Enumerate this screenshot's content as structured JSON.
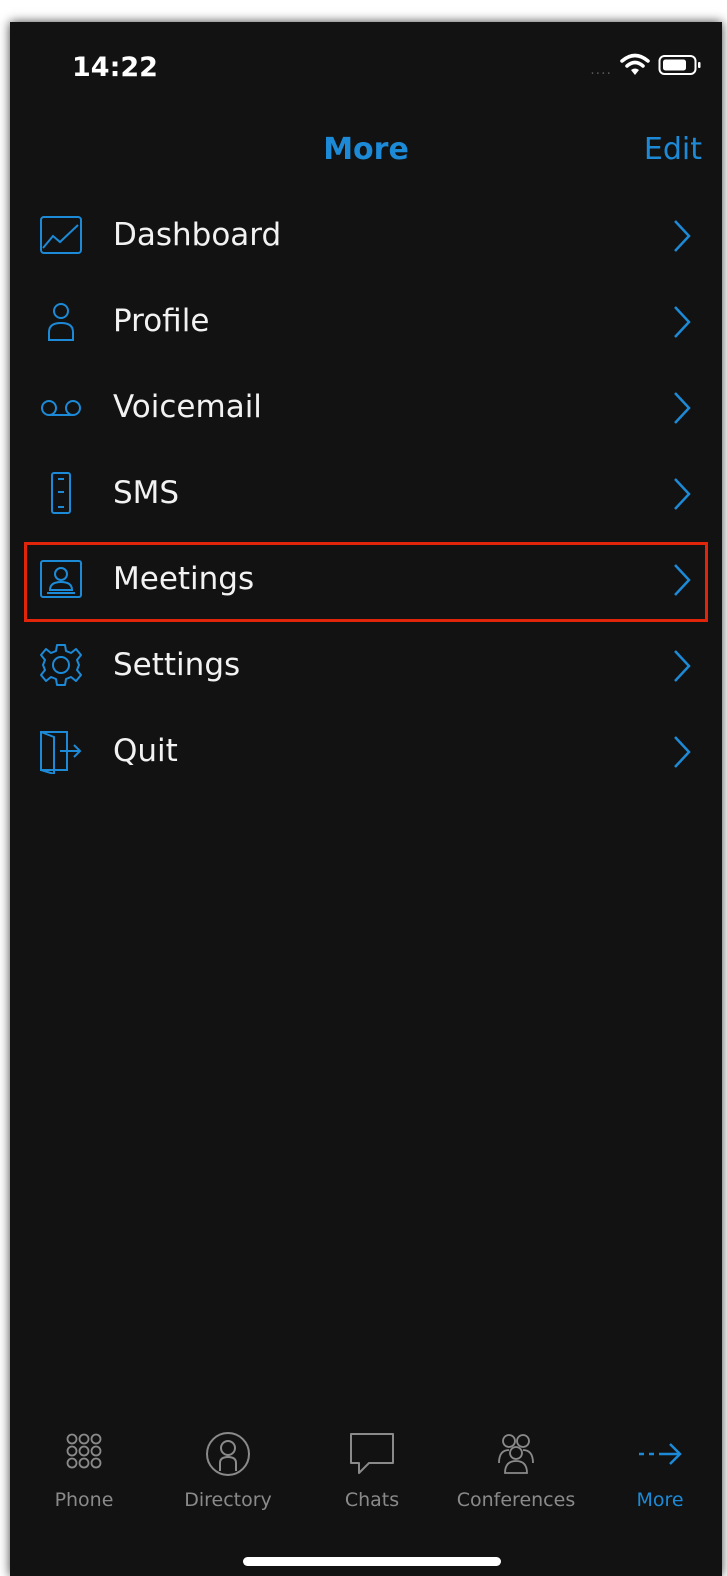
{
  "status_bar": {
    "time": "14:22",
    "signal_text": "...."
  },
  "nav": {
    "title": "More",
    "edit_label": "Edit"
  },
  "menu": {
    "items": [
      {
        "label": "Dashboard",
        "icon": "dashboard-chart-icon"
      },
      {
        "label": "Profile",
        "icon": "user-icon"
      },
      {
        "label": "Voicemail",
        "icon": "voicemail-icon"
      },
      {
        "label": "SMS",
        "icon": "mobile-phone-icon"
      },
      {
        "label": "Meetings",
        "icon": "meeting-icon",
        "highlighted": true
      },
      {
        "label": "Settings",
        "icon": "gear-icon"
      },
      {
        "label": "Quit",
        "icon": "exit-door-icon"
      }
    ]
  },
  "tabbar": {
    "tabs": [
      {
        "label": "Phone",
        "icon": "keypad-icon"
      },
      {
        "label": "Directory",
        "icon": "contact-circle-icon"
      },
      {
        "label": "Chats",
        "icon": "chat-bubble-icon"
      },
      {
        "label": "Conferences",
        "icon": "group-icon"
      },
      {
        "label": "More",
        "icon": "more-arrow-icon",
        "active": true
      }
    ]
  },
  "colors": {
    "accent": "#1c8ad7",
    "background": "#121212",
    "highlight_border": "#e0250b",
    "inactive_tab": "#8a8a8a"
  }
}
